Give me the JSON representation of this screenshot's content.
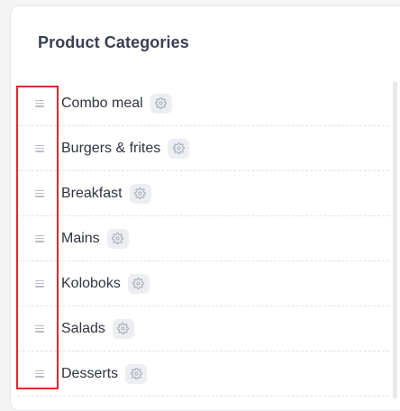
{
  "panel": {
    "title": "Product Categories"
  },
  "categories": [
    {
      "label": "Combo meal"
    },
    {
      "label": "Burgers & frites"
    },
    {
      "label": "Breakfast"
    },
    {
      "label": "Mains"
    },
    {
      "label": "Koloboks"
    },
    {
      "label": "Salads"
    },
    {
      "label": "Desserts"
    }
  ],
  "icons": {
    "drag": "drag-handle-icon",
    "settings": "gear-icon"
  },
  "colors": {
    "highlight": "#e3262d",
    "title": "#3a3f51",
    "text": "#2f3440",
    "gear_bg": "#eceef2"
  }
}
